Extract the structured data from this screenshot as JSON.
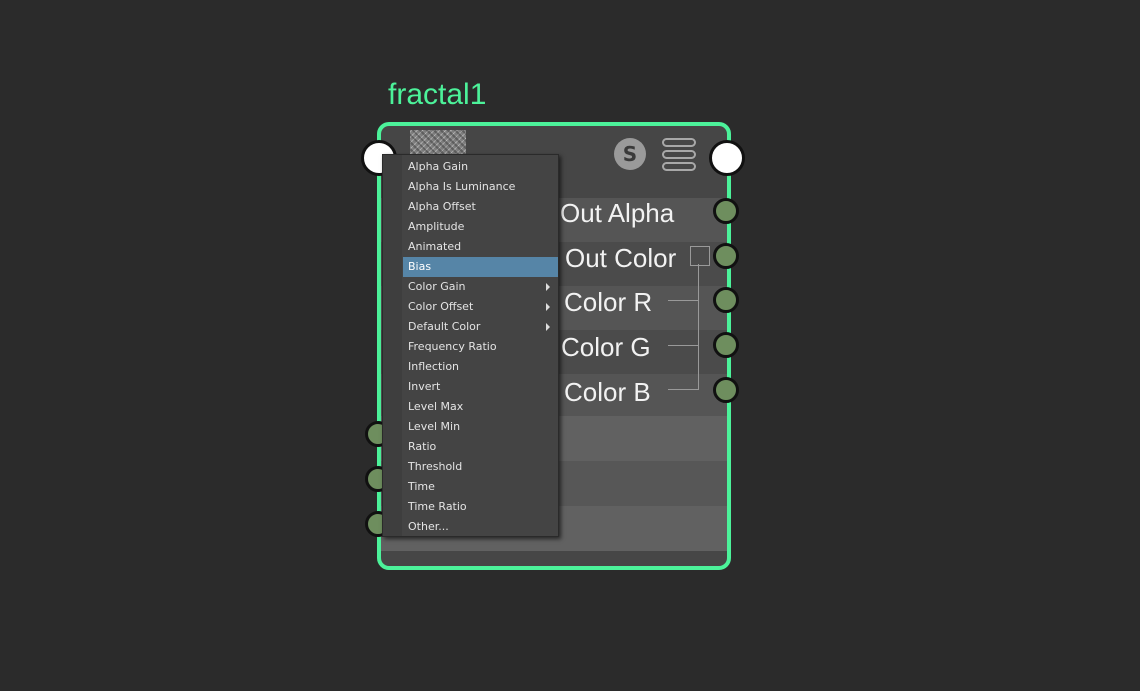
{
  "node": {
    "title": "fractal1",
    "attributes": [
      "Out Alpha",
      "Out Color",
      "Color R",
      "Color G",
      "Color B"
    ],
    "swatch_badge": "S"
  },
  "context_menu": {
    "items": [
      {
        "label": "Alpha Gain"
      },
      {
        "label": "Alpha Is Luminance"
      },
      {
        "label": "Alpha Offset"
      },
      {
        "label": "Amplitude"
      },
      {
        "label": "Animated"
      },
      {
        "label": "Bias",
        "highlighted": true
      },
      {
        "label": "Color Gain",
        "submenu": true
      },
      {
        "label": "Color Offset",
        "submenu": true
      },
      {
        "label": "Default Color",
        "submenu": true
      },
      {
        "label": "Frequency Ratio"
      },
      {
        "label": "Inflection"
      },
      {
        "label": "Invert"
      },
      {
        "label": "Level Max"
      },
      {
        "label": "Level Min"
      },
      {
        "label": "Ratio"
      },
      {
        "label": "Threshold"
      },
      {
        "label": "Time"
      },
      {
        "label": "Time Ratio"
      },
      {
        "label": "Other..."
      }
    ]
  },
  "colors": {
    "node_border": "#4cf29a",
    "highlight": "#5685a7",
    "port": "#6e8e5e"
  }
}
